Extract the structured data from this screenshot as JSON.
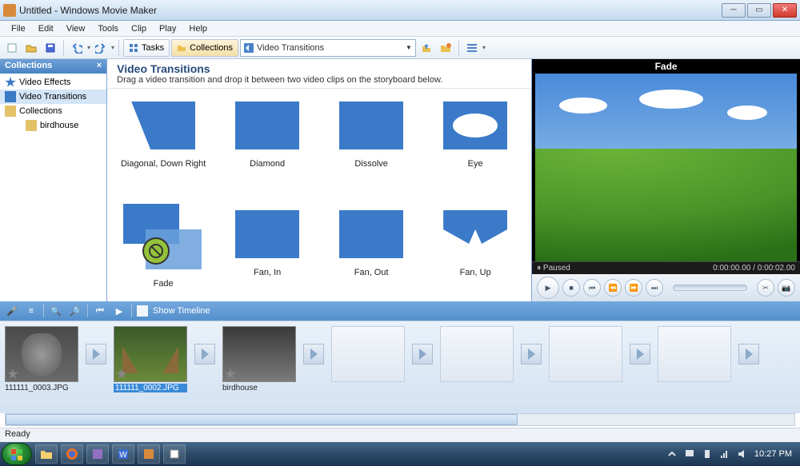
{
  "window": {
    "title": "Untitled - Windows Movie Maker"
  },
  "menu": {
    "items": [
      "File",
      "Edit",
      "View",
      "Tools",
      "Clip",
      "Play",
      "Help"
    ]
  },
  "toolbar": {
    "tasks_label": "Tasks",
    "collections_label": "Collections",
    "dropdown_value": "Video Transitions"
  },
  "sidebar": {
    "title": "Collections",
    "items": [
      {
        "label": "Video Effects",
        "icon": "star"
      },
      {
        "label": "Video Transitions",
        "icon": "arrow",
        "selected": true
      },
      {
        "label": "Collections",
        "icon": "folder"
      },
      {
        "label": "birdhouse",
        "icon": "folder",
        "indent": 2
      }
    ]
  },
  "content": {
    "heading": "Video Transitions",
    "hint": "Drag a video transition and drop it between two video clips on the storyboard below.",
    "transitions": [
      {
        "label": "Diagonal, Down Right",
        "shape": "sh-diag"
      },
      {
        "label": "Diamond",
        "shape": "sh-diamond"
      },
      {
        "label": "Dissolve",
        "shape": "sh-dissolve"
      },
      {
        "label": "Eye",
        "shape": "sh-eye"
      },
      {
        "label": "Fade",
        "shape": "fade",
        "selected": true
      },
      {
        "label": "Fan, In",
        "shape": "sh-fanin"
      },
      {
        "label": "Fan, Out",
        "shape": "sh-fanout"
      },
      {
        "label": "Fan, Up",
        "shape": "sh-fanup"
      }
    ]
  },
  "preview": {
    "title": "Fade",
    "status_label": "Paused",
    "time": "0:00:00.00 / 0:00:02.00"
  },
  "storyboard": {
    "timeline_toggle": "Show Timeline",
    "clips": [
      {
        "label": "111111_0003.JPG",
        "thumb": "statue"
      },
      {
        "label": "111111_0002.JPG",
        "thumb": "forest",
        "selected": true
      },
      {
        "label": "birdhouse",
        "thumb": "bird"
      }
    ]
  },
  "status": {
    "text": "Ready"
  },
  "taskbar": {
    "time": "10:27 PM"
  }
}
